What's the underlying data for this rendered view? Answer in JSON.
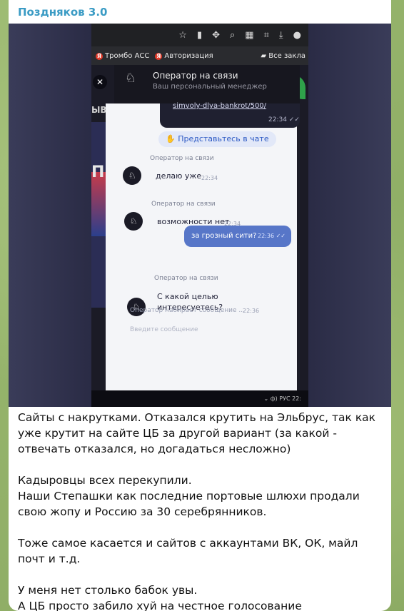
{
  "channel": {
    "sender_name": "Поздняков 3.0"
  },
  "photo": {
    "browser_icons": [
      "star-icon",
      "battery-icon",
      "extension-icon",
      "search-icon",
      "qr-icon",
      "crop-icon",
      "download-icon",
      "user-icon"
    ],
    "bookmarks": [
      {
        "icon": "ya",
        "label": "Тромбо АСС"
      },
      {
        "icon": "ya",
        "label": "Авторизация"
      },
      {
        "icon": "folder-icon",
        "label": "Все закла"
      }
    ],
    "site_partial_text": "ЫВ",
    "site_partial_big": "П",
    "widget": {
      "title": "Оператор на связи",
      "subtitle": "Ваш персональный менеджер",
      "link_text": "simvoly-dlya-bankrot/500/",
      "link_time": "22:34 ✓✓",
      "intro_button": "Представьтесь в чате",
      "messages": [
        {
          "label": "Оператор на связи",
          "text": "делаю уже",
          "time": "22:34"
        },
        {
          "label": "Оператор на связи",
          "text": "возможности нет",
          "time": "22:34"
        }
      ],
      "outgoing": {
        "text": "за грозный сити?",
        "time": "22:36 ✓✓"
      },
      "last_message": {
        "label": "Оператор на связи",
        "text": "С какой целью\nинтересуетесь?",
        "time": "22:36"
      },
      "typing": "Оператор набирает сообщение ...",
      "input_placeholder": "Введите сообщение"
    },
    "taskbar": "⌄  ф)  РУС  22:"
  },
  "caption": {
    "paragraphs": [
      "Сайты с накрутками. Отказался крутить на Эльбрус, так как уже крутит на сайте ЦБ за другой вариант (за какой - отвечать отказался, но догадаться несложно)",
      "Кадыровцы всех перекупили.\nНаши Степашки как последние портовые шлюхи продали свою жопу и Россию за 30 серебрянников.",
      "Тоже самое касается и сайтов с аккаунтами ВК, ОК, майл почт и т.д.",
      "У меня нет столько бабок увы.\nА ЦБ просто забило хуй на честное голосование"
    ]
  },
  "colors": {
    "sender": "#3a9bc4",
    "outgoing_bubble": "#5776c8",
    "chat_bg": "#8fae6a"
  }
}
